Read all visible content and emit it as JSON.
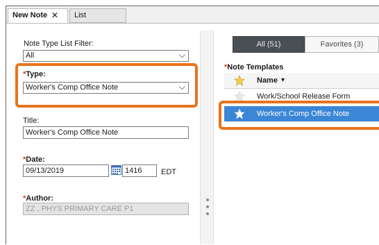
{
  "tabs": [
    {
      "label": "New Note",
      "active": true
    },
    {
      "label": "List",
      "active": false
    }
  ],
  "left": {
    "filter_label": "Note Type List Filter:",
    "filter_value": "All",
    "type_label": "Type:",
    "type_value": "Worker's Comp Office Note",
    "title_label": "Title:",
    "title_value": "Worker's Comp Office Note",
    "date_label": "Date:",
    "date_value": "09/13/2019",
    "time_value": "1416",
    "tz": "EDT",
    "author_label": "Author:",
    "author_value": "ZZ , PHYS PRIMARY CARE P1",
    "required_marker": "*"
  },
  "right": {
    "seg_all": "All (51)",
    "seg_fav": "Favorites (3)",
    "templates_label": "Note Templates",
    "col_name": "Name",
    "sort_glyph": "▾",
    "rows": [
      {
        "name": "Work/School Release Form",
        "favorite": true
      },
      {
        "name": "Worker's Comp Office Note",
        "favorite": true
      }
    ]
  },
  "colors": {
    "accent_orange": "#e8731c",
    "selection_blue": "#3b86d6",
    "required_red": "#d03a1a",
    "segment_dark": "#4a4f55"
  },
  "icons": {
    "close": "close-icon",
    "dropdown": "chevron-down-icon",
    "calendar": "calendar-icon",
    "favorite": "star-icon",
    "splitter": "drag-handle-icon"
  },
  "glyphs": {
    "close": "✕",
    "chevron": "⌵"
  }
}
